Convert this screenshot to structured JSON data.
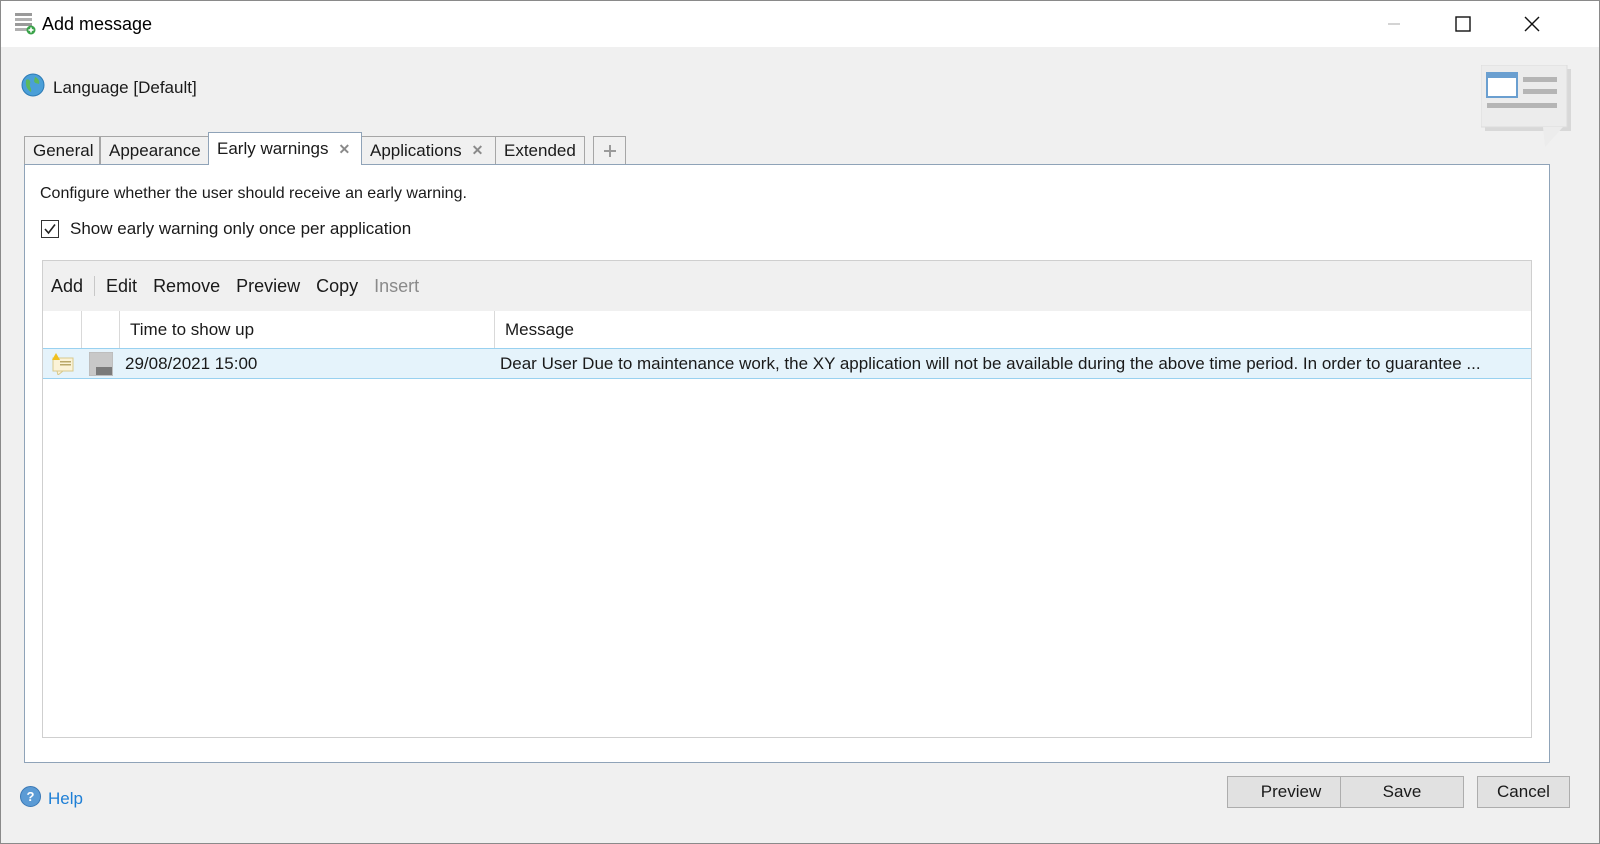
{
  "window": {
    "title": "Add message"
  },
  "language": {
    "label": "Language [Default]"
  },
  "tabs": [
    {
      "label": "General",
      "closable": false
    },
    {
      "label": "Appearance",
      "closable": false
    },
    {
      "label": "Early warnings",
      "closable": true,
      "active": true
    },
    {
      "label": "Applications",
      "closable": true
    },
    {
      "label": "Extended",
      "closable": false
    }
  ],
  "tab_add_icon": "plus-icon",
  "early_warnings": {
    "description": "Configure whether the user should receive an early warning.",
    "checkbox": {
      "label": "Show early warning only once per application",
      "checked": true
    },
    "toolbar": {
      "add": "Add",
      "edit": "Edit",
      "remove": "Remove",
      "preview": "Preview",
      "copy": "Copy",
      "insert": "Insert"
    },
    "columns": {
      "time": "Time to show up",
      "message": "Message"
    },
    "rows": [
      {
        "time": "29/08/2021 15:00",
        "message": "Dear User  Due to maintenance work, the XY application will not be available during the above time period. In order to guarantee ..."
      }
    ]
  },
  "footer": {
    "help": "Help",
    "preview": "Preview",
    "save": "Save",
    "cancel": "Cancel"
  },
  "colors": {
    "selection_bg": "#e5f3fb",
    "selection_border": "#99d1f0",
    "link": "#1e7fd6",
    "panel_border": "#8fa3b8"
  }
}
